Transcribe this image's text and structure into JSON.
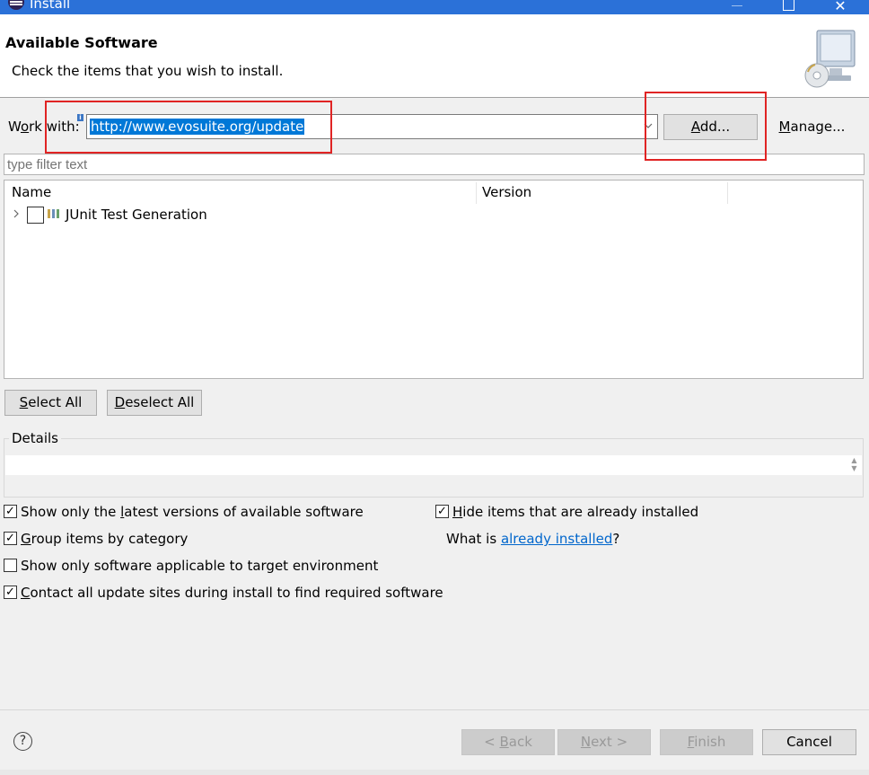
{
  "window": {
    "title": "Install",
    "accent": "#2b71d8"
  },
  "header": {
    "title": "Available Software",
    "description": "Check the items that you wish to install."
  },
  "work_with": {
    "label_pre": "W",
    "label_mn": "o",
    "label_post": "rk with:",
    "value": "http://www.evosuite.org/update",
    "add_pre": "",
    "add_mn": "A",
    "add_post": "dd...",
    "manage_pre": "",
    "manage_mn": "M",
    "manage_post": "anage..."
  },
  "filter": {
    "placeholder": "type filter text"
  },
  "table": {
    "columns": [
      "Name",
      "Version"
    ],
    "rows": [
      {
        "label": "JUnit Test Generation",
        "checked": false,
        "expander": "chevron-right-icon"
      }
    ]
  },
  "buttons": {
    "select_all_mn": "S",
    "select_all_post": "elect All",
    "deselect_all_mn": "D",
    "deselect_all_post": "eselect All",
    "back_pre": "< ",
    "back_mn": "B",
    "back_post": "ack",
    "next_mn": "N",
    "next_post": "ext >",
    "finish_mn": "F",
    "finish_post": "inish",
    "cancel": "Cancel"
  },
  "details": {
    "label": "Details"
  },
  "options": {
    "latest": {
      "pre": "Show only the ",
      "mn": "l",
      "post": "atest versions of available software",
      "checked": true
    },
    "group": {
      "pre": "",
      "mn": "G",
      "post": "roup items by category",
      "checked": true
    },
    "target": {
      "pre": "Show only software applicable to target environment",
      "mn": "",
      "post": "",
      "checked": false
    },
    "contact": {
      "pre": "",
      "mn": "C",
      "post": "ontact all update sites during install to find required software",
      "checked": true
    },
    "hide": {
      "pre": "",
      "mn": "H",
      "post": "ide items that are already installed",
      "checked": true
    },
    "whatis_pre": "What is ",
    "whatis_link": "already installed",
    "whatis_post": "?"
  },
  "colors": {
    "selection": "#0078d7",
    "link": "#0066cc",
    "annotation": "#e02424"
  }
}
